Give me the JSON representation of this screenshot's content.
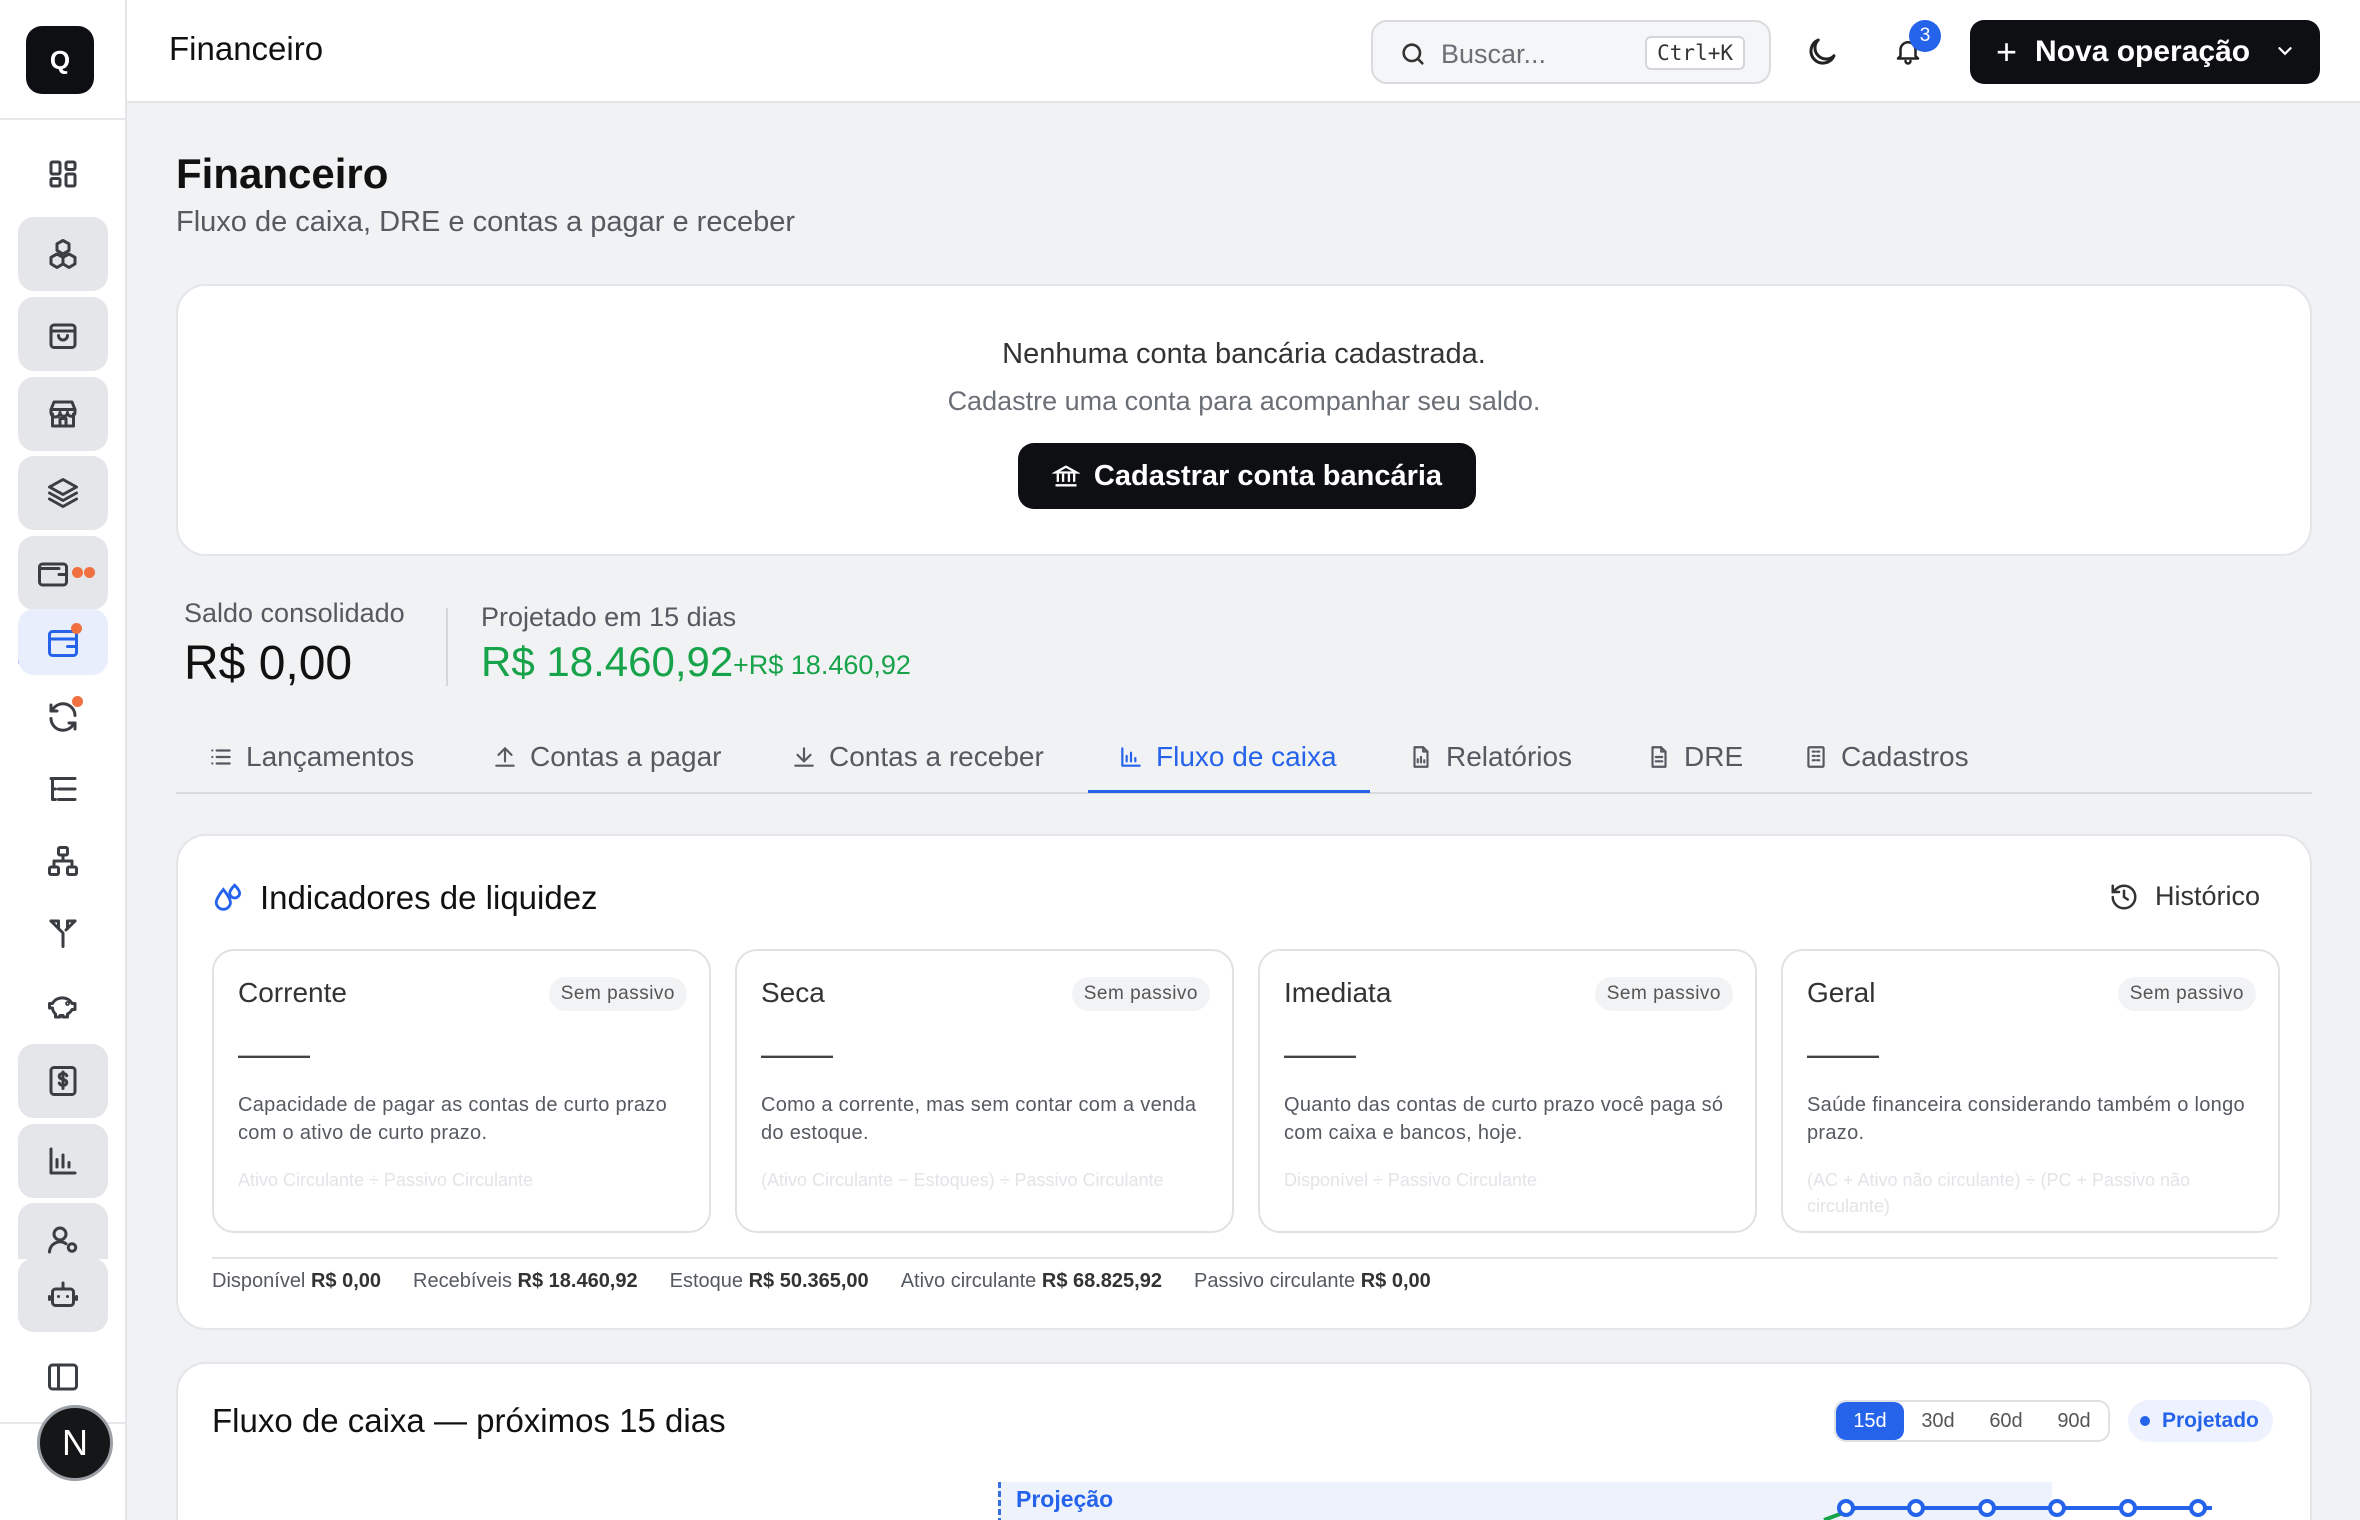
{
  "sidebar": {
    "logo": "Q",
    "avatar": "N"
  },
  "header": {
    "title": "Financeiro",
    "search_placeholder": "Buscar...",
    "search_shortcut": "Ctrl+K",
    "notifications_count": "3",
    "primary_button": "Nova operação"
  },
  "page": {
    "title": "Financeiro",
    "subtitle": "Fluxo de caixa, DRE e contas a pagar e receber"
  },
  "bank": {
    "empty_title": "Nenhuma conta bancária cadastrada.",
    "empty_hint": "Cadastre uma conta para acompanhar seu saldo.",
    "button": "Cadastrar conta bancária"
  },
  "balances": {
    "consolidated_label": "Saldo consolidado",
    "consolidated_value": "R$ 0,00",
    "projected_label": "Projetado em 15 dias",
    "projected_value": "R$ 18.460,92",
    "projected_delta": "+R$ 18.460,92"
  },
  "tabs": [
    {
      "label": "Lançamentos"
    },
    {
      "label": "Contas a pagar"
    },
    {
      "label": "Contas a receber"
    },
    {
      "label": "Fluxo de caixa",
      "active": true
    },
    {
      "label": "Relatórios"
    },
    {
      "label": "DRE"
    },
    {
      "label": "Cadastros"
    }
  ],
  "liquidity": {
    "title": "Indicadores de liquidez",
    "history_button": "Histórico",
    "indicators": [
      {
        "name": "Corrente",
        "badge": "Sem passivo",
        "value": "——",
        "description": "Capacidade de pagar as contas de curto prazo com o ativo de curto prazo.",
        "formula": "Ativo Circulante ÷ Passivo Circulante"
      },
      {
        "name": "Seca",
        "badge": "Sem passivo",
        "value": "——",
        "description": "Como a corrente, mas sem contar com a venda do estoque.",
        "formula": "(Ativo Circulante − Estoques) ÷ Passivo Circulante"
      },
      {
        "name": "Imediata",
        "badge": "Sem passivo",
        "value": "——",
        "description": "Quanto das contas de curto prazo você paga só com caixa e bancos, hoje.",
        "formula": "Disponível ÷ Passivo Circulante"
      },
      {
        "name": "Geral",
        "badge": "Sem passivo",
        "value": "——",
        "description": "Saúde financeira considerando também o longo prazo.",
        "formula": "(AC + Ativo não circulante) ÷ (PC + Passivo não circulante)"
      }
    ],
    "footer": [
      {
        "label": "Disponível",
        "value": "R$ 0,00"
      },
      {
        "label": "Recebíveis",
        "value": "R$ 18.460,92"
      },
      {
        "label": "Estoque",
        "value": "R$ 50.365,00"
      },
      {
        "label": "Ativo circulante",
        "value": "R$ 68.825,92"
      },
      {
        "label": "Passivo circulante",
        "value": "R$ 0,00"
      }
    ]
  },
  "cashflow": {
    "title": "Fluxo de caixa — próximos 15 dias",
    "ranges": [
      "15d",
      "30d",
      "60d",
      "90d"
    ],
    "selected_range": "15d",
    "legend": "Projetado",
    "chart_label": "Projeção"
  },
  "colors": {
    "accent": "#2563eb",
    "positive": "#16a34a",
    "alert_dot": "#f07040",
    "dark_button": "#0d0f12"
  }
}
